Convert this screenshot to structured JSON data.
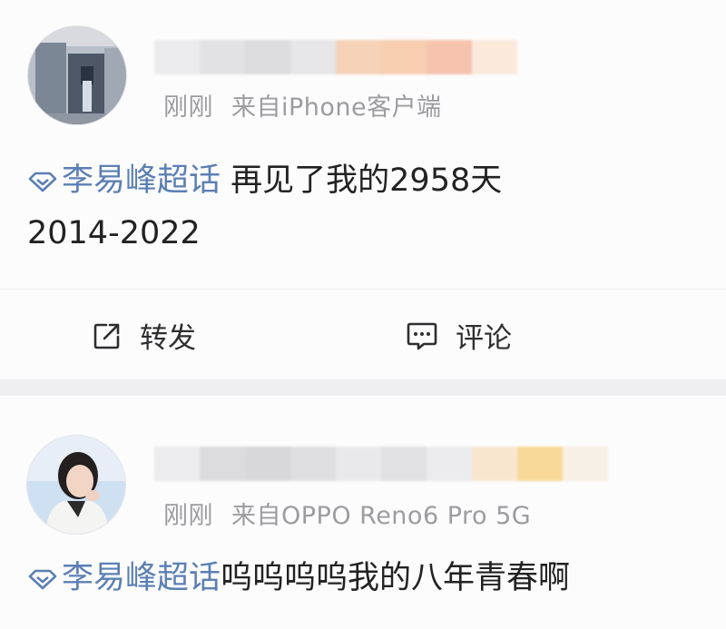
{
  "posts": [
    {
      "time": "刚刚",
      "source": "来自iPhone客户端",
      "topic": "李易峰超话",
      "text": "再见了我的2958天",
      "text_line2": "2014-2022",
      "actions": {
        "repost": "转发",
        "comment": "评论"
      },
      "avatar_icon": "avatar-photo-doorway",
      "name_blur_colors": [
        "#ececee",
        "#e2e2e4",
        "#dcdcde",
        "#e6e6e8",
        "#f6d2b8",
        "#f7ceb0",
        "#f6c4ae",
        "#fbe9dc"
      ]
    },
    {
      "time": "刚刚",
      "source": "来自OPPO Reno6 Pro 5G",
      "topic": "李易峰超话",
      "text": "呜呜呜呜我的八年青春啊",
      "avatar_icon": "avatar-photo-woman",
      "name_blur_colors": [
        "#ededef",
        "#dcdcde",
        "#d8d8da",
        "#dfdfe1",
        "#e9e9eb",
        "#e1e1e3",
        "#ececee",
        "#f9e6cf",
        "#f8d998",
        "#f6f0e6"
      ]
    }
  ],
  "colors": {
    "topic": "#5b7fb4",
    "meta": "#9c9ca0",
    "divider": "#efeff1"
  }
}
